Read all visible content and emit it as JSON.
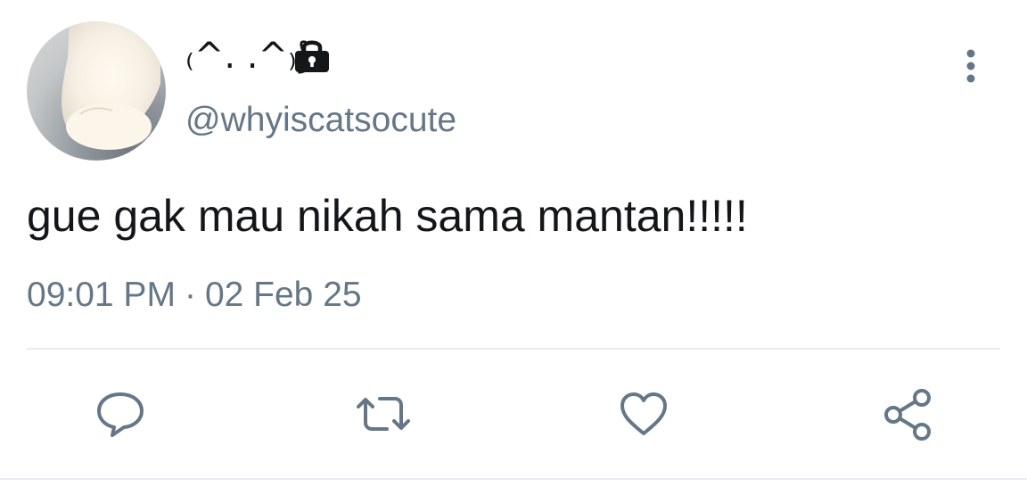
{
  "tweet": {
    "display_name": "₍^. .^₎⟆",
    "locked": true,
    "handle": "@whyiscatsocute",
    "text": "gue gak mau nikah sama mantan!!!!!",
    "time": "09:01 PM",
    "separator": "·",
    "date": "02 Feb 25"
  },
  "icons": {
    "lock": "lock-icon",
    "more": "more-vertical-icon",
    "reply": "reply-icon",
    "retweet": "retweet-icon",
    "like": "heart-icon",
    "share": "share-icon"
  },
  "colors": {
    "text": "#14171a",
    "secondary": "#657786",
    "divider": "#e6ecf0"
  }
}
